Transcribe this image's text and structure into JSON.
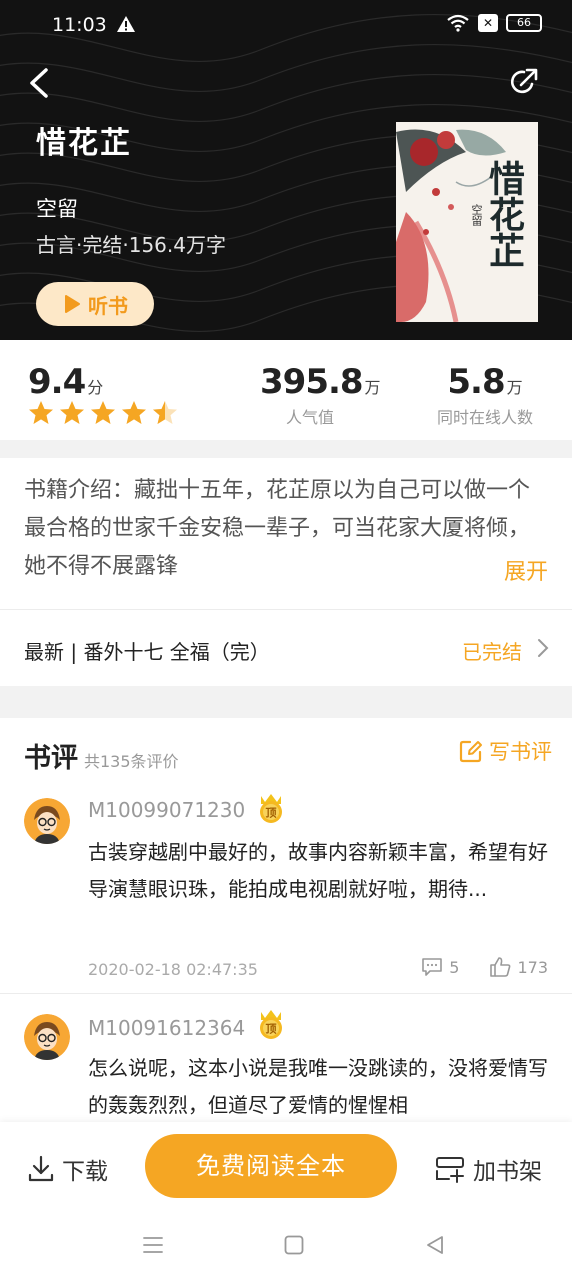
{
  "status_bar": {
    "time": "11:03",
    "battery": "66"
  },
  "book": {
    "title": "惜花芷",
    "author": "空留",
    "meta": "古言·完结·156.4万字",
    "listen_label": "听书",
    "cover": {
      "title": "惜花芷",
      "author": "空留"
    }
  },
  "stats": {
    "score": "9.4",
    "score_unit": "分",
    "stars": 4.5,
    "popularity": "395.8",
    "popularity_unit": "万",
    "popularity_label": "人气值",
    "online": "5.8",
    "online_unit": "万",
    "online_label": "同时在线人数"
  },
  "intro": {
    "text": "书籍介绍：藏拙十五年，花芷原以为自己可以做一个最合格的世家千金安稳一辈子，可当花家大厦将倾，她不得不展露锋",
    "expand_label": "展开"
  },
  "latest": {
    "text": "最新 | 番外十七  全福（完）",
    "status": "已完结"
  },
  "reviews": {
    "title": "书评",
    "count": "共135条评价",
    "write_label": "写书评",
    "items": [
      {
        "user": "M10099071230",
        "text": "古装穿越剧中最好的，故事内容新颖丰富，希望有好导演慧眼识珠，能拍成电视剧就好啦，期待...",
        "time": "2020-02-18 02:47:35",
        "comments": "5",
        "likes": "173"
      },
      {
        "user": "M10091612364",
        "text": "怎么说呢，这本小说是我唯一没跳读的，没将爱情写的轰轰烈烈，但道尽了爱情的惺惺相"
      }
    ]
  },
  "bottom_bar": {
    "download_label": "下载",
    "read_label": "免费阅读全本",
    "shelf_label": "加书架"
  },
  "colors": {
    "accent": "#f5a623",
    "dark_header": "#121212"
  }
}
